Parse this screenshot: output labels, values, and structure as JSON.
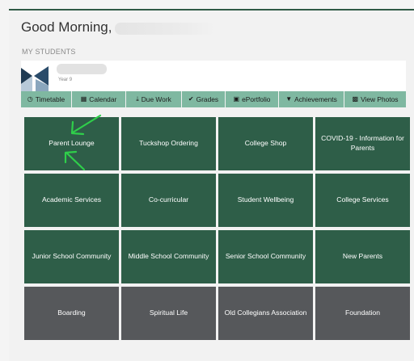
{
  "header": {
    "greeting": "Good Morning,"
  },
  "students": {
    "section_label": "MY STUDENTS",
    "student": {
      "year": "Year 9"
    }
  },
  "tabs": [
    {
      "label": "Timetable",
      "icon": "clock-icon"
    },
    {
      "label": "Calendar",
      "icon": "calendar-icon"
    },
    {
      "label": "Due Work",
      "icon": "upload-icon"
    },
    {
      "label": "Grades",
      "icon": "check-icon"
    },
    {
      "label": "ePortfolio",
      "icon": "briefcase-icon"
    },
    {
      "label": "Achievements",
      "icon": "trophy-icon"
    },
    {
      "label": "View Photos",
      "icon": "photos-icon"
    }
  ],
  "tiles": [
    {
      "label": "Parent Lounge",
      "color": "#2e5e48"
    },
    {
      "label": "Tuckshop Ordering",
      "color": "#2e5e48"
    },
    {
      "label": "College Shop",
      "color": "#2e5e48"
    },
    {
      "label": "COVID-19 - Information for Parents",
      "color": "#2e5e48"
    },
    {
      "label": "Academic Services",
      "color": "#2e5e48"
    },
    {
      "label": "Co-curricular",
      "color": "#2e5e48"
    },
    {
      "label": "Student Wellbeing",
      "color": "#2e5e48"
    },
    {
      "label": "College Services",
      "color": "#2e5e48"
    },
    {
      "label": "Junior School Community",
      "color": "#2e5e48"
    },
    {
      "label": "Middle School Community",
      "color": "#2e5e48"
    },
    {
      "label": "Senior School Community",
      "color": "#2e5e48"
    },
    {
      "label": "New Parents",
      "color": "#2e5e48"
    },
    {
      "label": "Boarding",
      "color": "#56585b"
    },
    {
      "label": "Spiritual Life",
      "color": "#56585b"
    },
    {
      "label": "Old Collegians Association",
      "color": "#56585b"
    },
    {
      "label": "Foundation",
      "color": "#56585b"
    }
  ],
  "colors": {
    "accent": "#2e5e48",
    "tab_bar": "#7fb8a1",
    "tile_grey": "#56585b",
    "annotation_arrow": "#2fcf4a"
  }
}
